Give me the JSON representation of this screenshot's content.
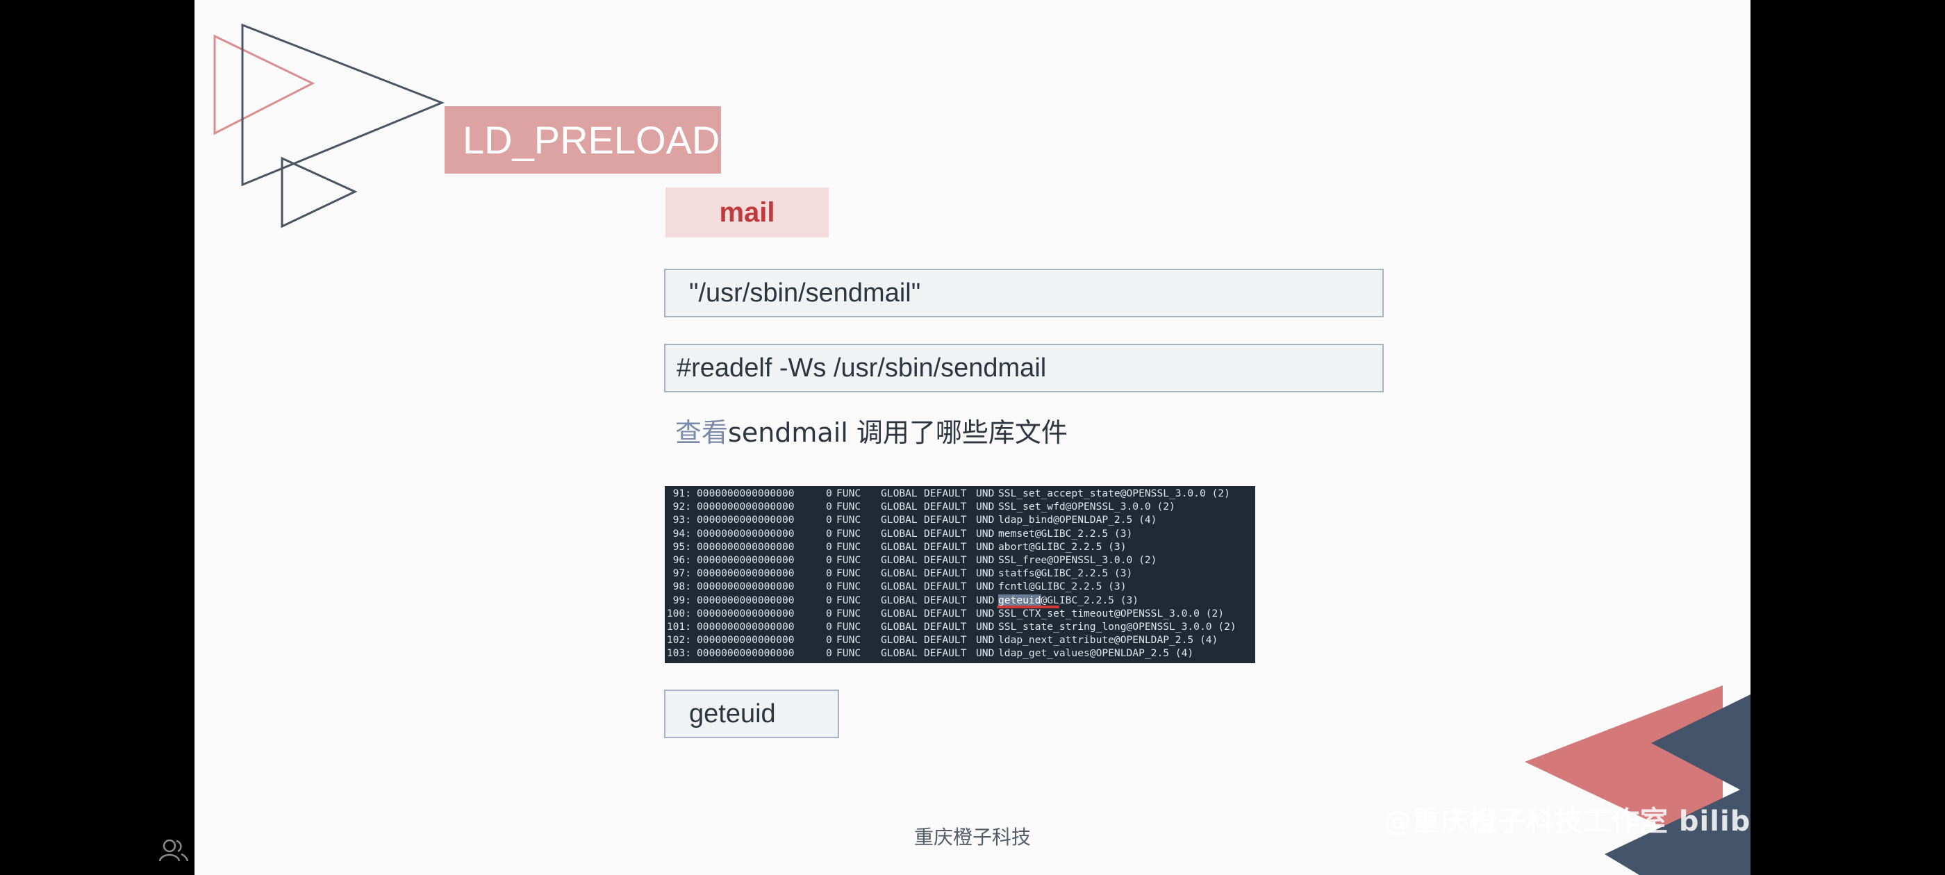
{
  "slide": {
    "title": "LD_PRELOAD",
    "subtitle": "mail",
    "path_field": "\"/usr/sbin/sendmail\"",
    "command_field": "#readelf -Ws /usr/sbin/sendmail",
    "caption_highlight": "查看",
    "caption_rest": "sendmail 调用了哪些库文件",
    "result": "geteuid",
    "footer": "重庆橙子科技"
  },
  "terminal": {
    "rows": [
      {
        "num": "91:",
        "addr": "0000000000000000",
        "size": "0",
        "type": "FUNC",
        "bind": "GLOBAL",
        "vis": "DEFAULT",
        "ndx": "UND",
        "sym": "SSL_set_accept_state@OPENSSL_3.0.0 (2)"
      },
      {
        "num": "92:",
        "addr": "0000000000000000",
        "size": "0",
        "type": "FUNC",
        "bind": "GLOBAL",
        "vis": "DEFAULT",
        "ndx": "UND",
        "sym": "SSL_set_wfd@OPENSSL_3.0.0 (2)"
      },
      {
        "num": "93:",
        "addr": "0000000000000000",
        "size": "0",
        "type": "FUNC",
        "bind": "GLOBAL",
        "vis": "DEFAULT",
        "ndx": "UND",
        "sym": "ldap_bind@OPENLDAP_2.5 (4)"
      },
      {
        "num": "94:",
        "addr": "0000000000000000",
        "size": "0",
        "type": "FUNC",
        "bind": "GLOBAL",
        "vis": "DEFAULT",
        "ndx": "UND",
        "sym": "memset@GLIBC_2.2.5 (3)"
      },
      {
        "num": "95:",
        "addr": "0000000000000000",
        "size": "0",
        "type": "FUNC",
        "bind": "GLOBAL",
        "vis": "DEFAULT",
        "ndx": "UND",
        "sym": "abort@GLIBC_2.2.5 (3)"
      },
      {
        "num": "96:",
        "addr": "0000000000000000",
        "size": "0",
        "type": "FUNC",
        "bind": "GLOBAL",
        "vis": "DEFAULT",
        "ndx": "UND",
        "sym": "SSL_free@OPENSSL_3.0.0 (2)"
      },
      {
        "num": "97:",
        "addr": "0000000000000000",
        "size": "0",
        "type": "FUNC",
        "bind": "GLOBAL",
        "vis": "DEFAULT",
        "ndx": "UND",
        "sym": "statfs@GLIBC_2.2.5 (3)"
      },
      {
        "num": "98:",
        "addr": "0000000000000000",
        "size": "0",
        "type": "FUNC",
        "bind": "GLOBAL",
        "vis": "DEFAULT",
        "ndx": "UND",
        "sym": "fcntl@GLIBC_2.2.5 (3)"
      },
      {
        "num": "99:",
        "addr": "0000000000000000",
        "size": "0",
        "type": "FUNC",
        "bind": "GLOBAL",
        "vis": "DEFAULT",
        "ndx": "UND",
        "sym_mark": "geteuid",
        "sym": "@GLIBC_2.2.5 (3)"
      },
      {
        "num": "100:",
        "addr": "0000000000000000",
        "size": "0",
        "type": "FUNC",
        "bind": "GLOBAL",
        "vis": "DEFAULT",
        "ndx": "UND",
        "sym": "SSL_CTX_set_timeout@OPENSSL_3.0.0 (2)"
      },
      {
        "num": "101:",
        "addr": "0000000000000000",
        "size": "0",
        "type": "FUNC",
        "bind": "GLOBAL",
        "vis": "DEFAULT",
        "ndx": "UND",
        "sym": "SSL_state_string_long@OPENSSL_3.0.0 (2)"
      },
      {
        "num": "102:",
        "addr": "0000000000000000",
        "size": "0",
        "type": "FUNC",
        "bind": "GLOBAL",
        "vis": "DEFAULT",
        "ndx": "UND",
        "sym": "ldap_next_attribute@OPENLDAP_2.5 (4)"
      },
      {
        "num": "103:",
        "addr": "0000000000000000",
        "size": "0",
        "type": "FUNC",
        "bind": "GLOBAL",
        "vis": "DEFAULT",
        "ndx": "UND",
        "sym": "ldap_get_values@OPENLDAP_2.5 (4)"
      }
    ]
  },
  "watermark": "@重庆橙子科技工作室 bilibili",
  "colors": {
    "page_bg": "#fafafa",
    "title_bg": "#dda3a3",
    "subtitle_text": "#c0393b",
    "terminal_bg": "#1f2a35",
    "accent_red": "#d4787a",
    "accent_navy": "#44546a"
  },
  "icons": {
    "left_bottom": "people-icon"
  }
}
